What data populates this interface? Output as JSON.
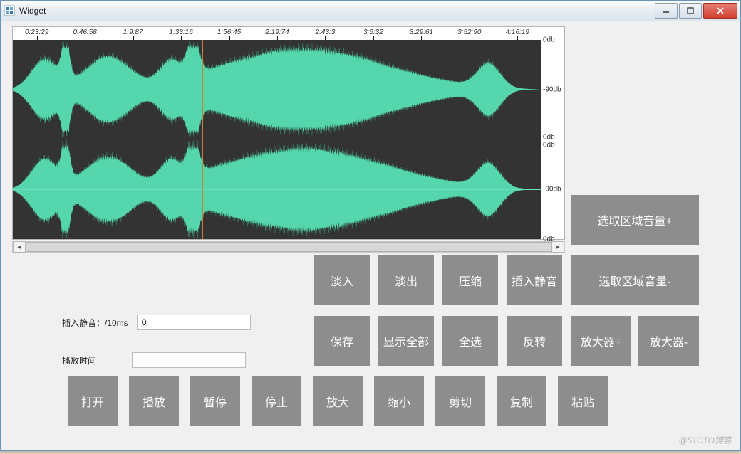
{
  "window": {
    "title": "Widget"
  },
  "ruler_times": [
    "0:23:29",
    "0:46:58",
    "1:9:87",
    "1:33:16",
    "1:56:45",
    "2:19:74",
    "2:43:3",
    "3:6:32",
    "3:29:61",
    "3:52:90",
    "4:16:19"
  ],
  "db_labels": {
    "top_0": "0db",
    "top_neg90": "-90db",
    "mid_0a": "0db",
    "mid_0b": "0db",
    "bot_neg90": "-90db",
    "bot_0": "0db"
  },
  "form": {
    "insert_silence_label": "插入静音：/10ms",
    "insert_silence_value": "0",
    "play_time_label": "播放时间",
    "play_time_value": ""
  },
  "buttons": {
    "sel_vol_up": "选取区域音量+",
    "fade_in": "淡入",
    "fade_out": "淡出",
    "compress": "压缩",
    "insert_silence": "插入静音",
    "sel_vol_down": "选取区域音量-",
    "save": "保存",
    "show_all": "显示全部",
    "select_all": "全选",
    "invert": "反转",
    "amp_up": "放大器+",
    "amp_down": "放大器-",
    "open": "打开",
    "play": "播放",
    "pause": "暂停",
    "stop": "停止",
    "zoom_in": "放大",
    "zoom_out": "缩小",
    "cut": "剪切",
    "copy": "复制",
    "paste": "粘贴"
  },
  "cursor_fraction": 0.358,
  "watermark": "@51CTO博客"
}
